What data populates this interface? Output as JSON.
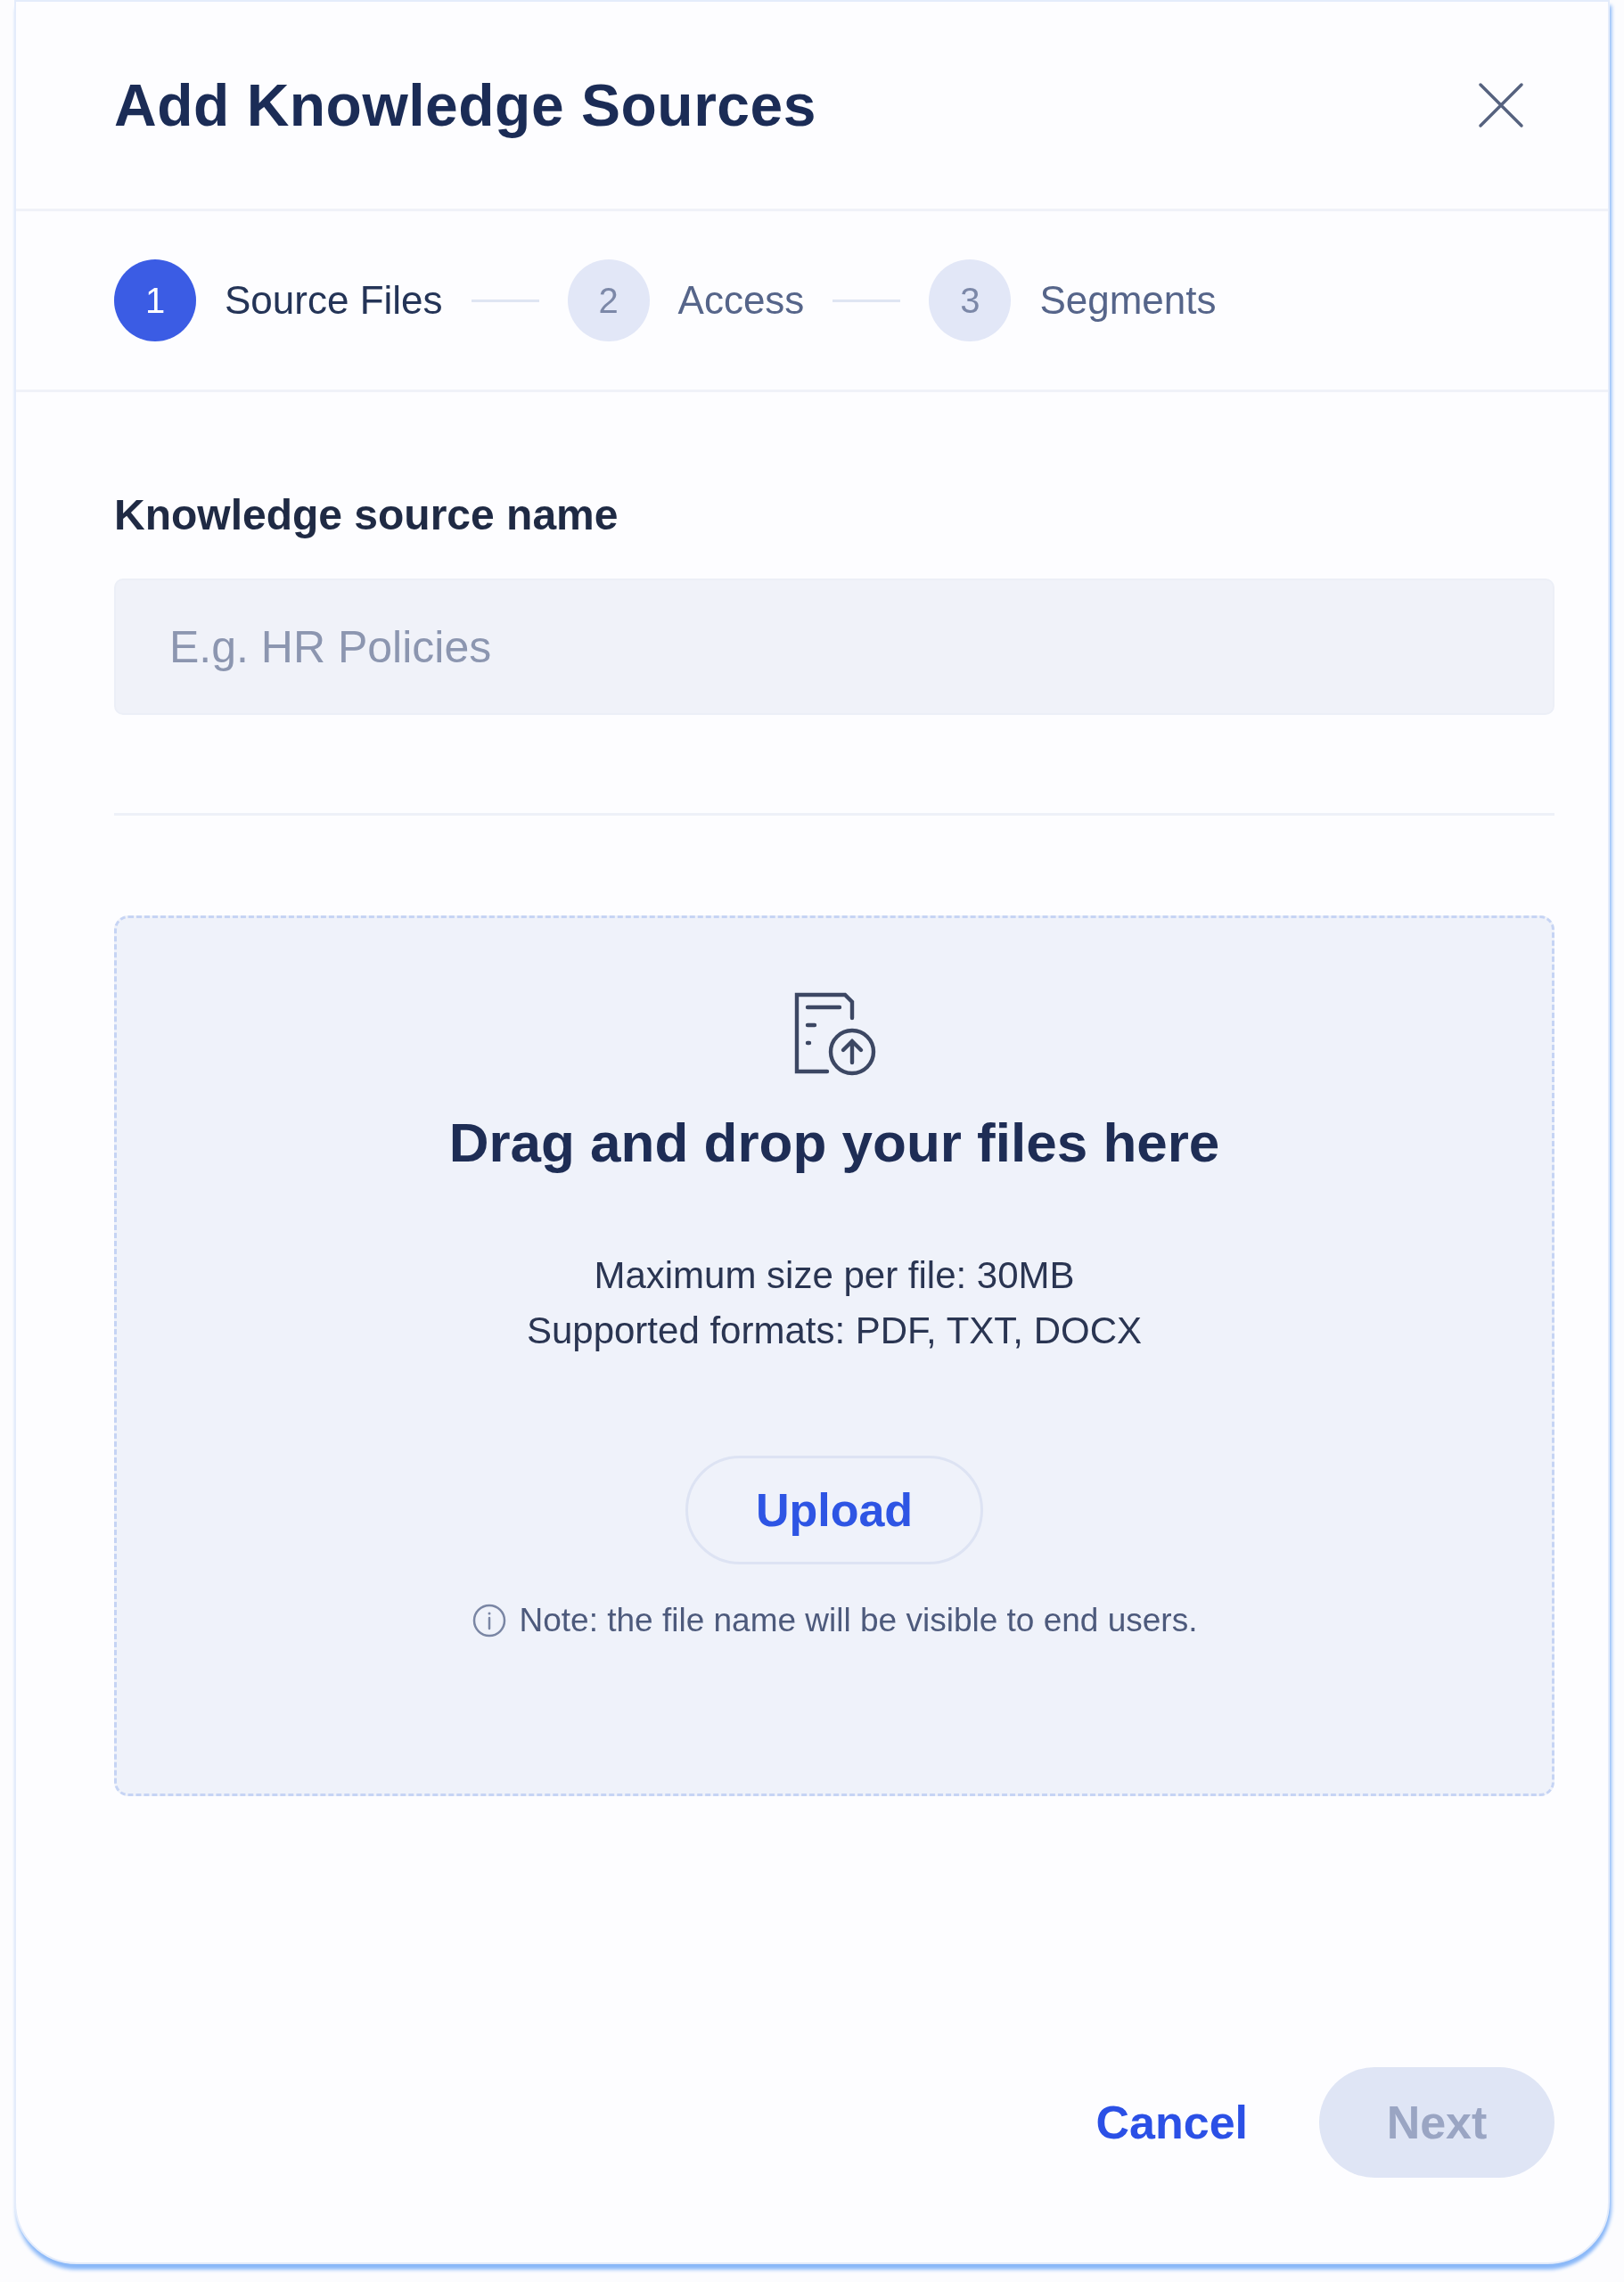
{
  "dialog": {
    "title": "Add Knowledge Sources"
  },
  "steps": [
    {
      "number": "1",
      "label": "Source Files",
      "selected": true
    },
    {
      "number": "2",
      "label": "Access",
      "selected": false
    },
    {
      "number": "3",
      "label": "Segments",
      "selected": false
    }
  ],
  "name_field": {
    "label": "Knowledge source name",
    "placeholder": "E.g. HR Policies"
  },
  "dropzone": {
    "heading": "Drag and drop your files here",
    "lines": [
      "Maximum size per file: 30MB",
      "Supported formats: PDF, TXT, DOCX"
    ],
    "upload_button": "Upload",
    "note": "Note: the file name will be visible to end users."
  },
  "footer": {
    "cancel": "Cancel",
    "next": {
      "label": "Next",
      "disabled": true
    }
  }
}
